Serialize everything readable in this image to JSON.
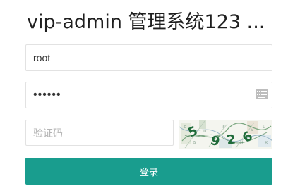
{
  "app": {
    "title": "vip-admin 管理系统123 ..."
  },
  "login_form": {
    "username": {
      "value": "root"
    },
    "password": {
      "value": "123456",
      "icon": "keyboard-icon"
    },
    "captcha": {
      "placeholder": "验证码",
      "value": ""
    },
    "captcha_image": {
      "text": "5926"
    },
    "submit_label": "登录"
  },
  "colors": {
    "accent": "#199d8e",
    "border": "#e2e2e2",
    "placeholder": "#b5b5b5",
    "captcha_text": "#1f6b3a"
  }
}
